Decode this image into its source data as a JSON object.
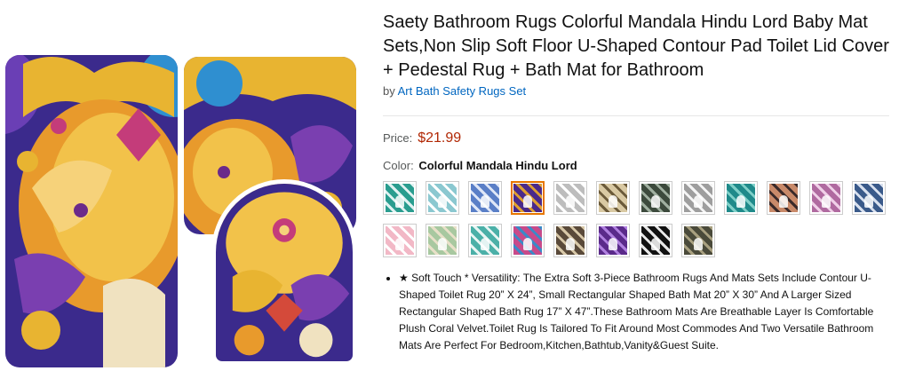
{
  "product": {
    "title": "Saety Bathroom Rugs Colorful Mandala Hindu Lord Baby Mat Sets,Non Slip Soft Floor U-Shaped Contour Pad Toilet Lid Cover + Pedestal Rug + Bath Mat for Bathroom",
    "by_prefix": "by",
    "brand": "Art Bath Safety Rugs Set",
    "price_label": "Price:",
    "price": "$21.99",
    "color_label": "Color:",
    "color_value": "Colorful Mandala Hindu Lord"
  },
  "swatches": [
    {
      "name": "swatch-1",
      "colors": [
        "#2a9d8f",
        "#e0f2f1"
      ]
    },
    {
      "name": "swatch-2",
      "colors": [
        "#8bc8d0",
        "#ffffff"
      ]
    },
    {
      "name": "swatch-3",
      "colors": [
        "#5a7fc7",
        "#dfe7f7"
      ]
    },
    {
      "name": "swatch-4",
      "colors": [
        "#4b2a8a",
        "#e0a030"
      ],
      "selected": true
    },
    {
      "name": "swatch-5",
      "colors": [
        "#bdbdbd",
        "#ffffff"
      ]
    },
    {
      "name": "swatch-6",
      "colors": [
        "#d9c9a3",
        "#6b5a3a"
      ]
    },
    {
      "name": "swatch-7",
      "colors": [
        "#3c4a3c",
        "#a0b0a0"
      ]
    },
    {
      "name": "swatch-8",
      "colors": [
        "#9e9e9e",
        "#f5f5f5"
      ]
    },
    {
      "name": "swatch-9",
      "colors": [
        "#1f8a8a",
        "#7fd0c8"
      ]
    },
    {
      "name": "swatch-10",
      "colors": [
        "#c98a6a",
        "#3a2a2a"
      ]
    },
    {
      "name": "swatch-11",
      "colors": [
        "#b06aa0",
        "#f0d0e8"
      ]
    },
    {
      "name": "swatch-12",
      "colors": [
        "#3a5a8a",
        "#d8e0ee"
      ]
    },
    {
      "name": "swatch-13",
      "colors": [
        "#f2b8c6",
        "#ffffff"
      ]
    },
    {
      "name": "swatch-14",
      "colors": [
        "#a8c8a0",
        "#e8e0c8"
      ]
    },
    {
      "name": "swatch-15",
      "colors": [
        "#4bb0a8",
        "#e8f5f3"
      ]
    },
    {
      "name": "swatch-16",
      "colors": [
        "#c84a8a",
        "#3a8ac8"
      ]
    },
    {
      "name": "swatch-17",
      "colors": [
        "#5a4a3a",
        "#d8c8a8"
      ]
    },
    {
      "name": "swatch-18",
      "colors": [
        "#5a2a8a",
        "#b080e0"
      ]
    },
    {
      "name": "swatch-19",
      "colors": [
        "#111111",
        "#e8e8e8"
      ]
    },
    {
      "name": "swatch-20",
      "colors": [
        "#4a4a3a",
        "#a8a080"
      ]
    }
  ],
  "bullets": [
    "★ Soft Touch * Versatility: The Extra Soft 3-Piece Bathroom Rugs And Mats Sets Include Contour U-Shaped Toilet Rug 20” X 24”, Small Rectangular Shaped Bath Mat 20” X 30” And A Larger Sized Rectangular Shaped Bath Rug 17” X 47”.These Bathroom Mats Are Breathable Layer Is Comfortable Plush Coral Velvet.Toilet Rug Is Tailored To Fit Around Most Commodes And Two Versatile Bathroom Mats Are Perfect For Bedroom,Kitchen,Bathtub,Vanity&Guest Suite."
  ],
  "colors": {
    "price": "#B12704",
    "link": "#0066c0",
    "selected_border": "#e77600"
  }
}
